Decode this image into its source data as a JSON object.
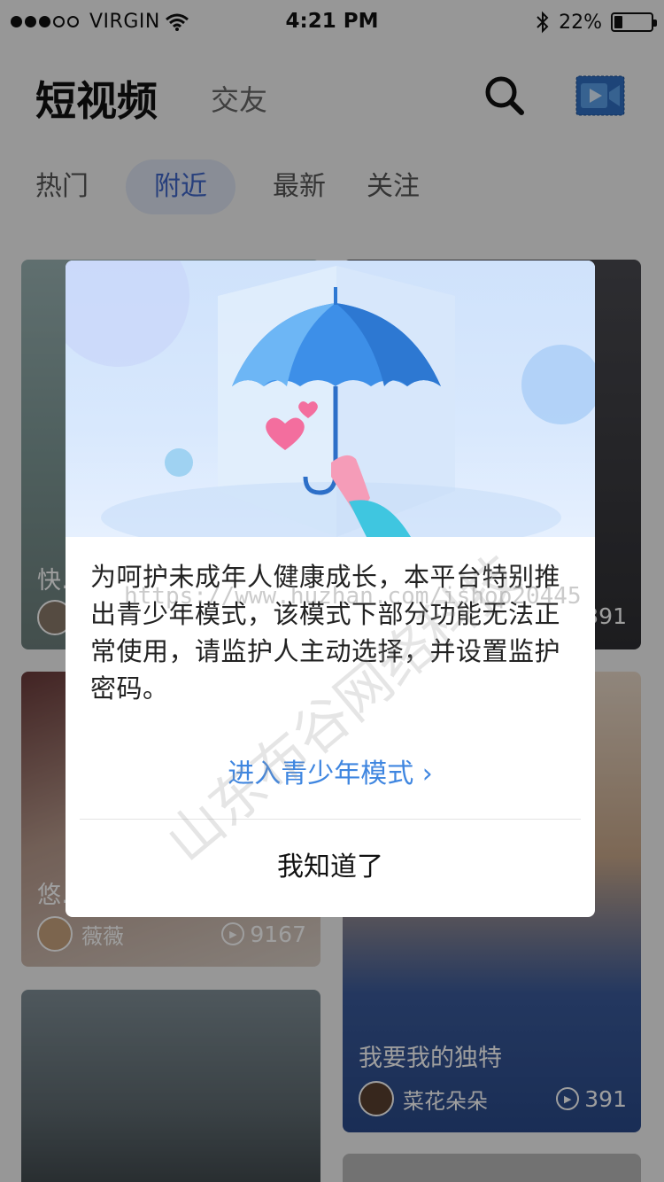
{
  "status_bar": {
    "carrier": "VIRGIN",
    "time": "4:21 PM",
    "battery": "22%",
    "battery_level": 0.22
  },
  "header": {
    "title": "短视频",
    "secondary_tab": "交友"
  },
  "tabs": [
    {
      "label": "热门",
      "active": false
    },
    {
      "label": "附近",
      "active": true
    },
    {
      "label": "最新",
      "active": false
    },
    {
      "label": "关注",
      "active": false
    }
  ],
  "feed": [
    {
      "title": "快…",
      "user": "",
      "views": ""
    },
    {
      "title": "",
      "user": "",
      "views": "391"
    },
    {
      "title": "悠…",
      "user": "薇薇",
      "views": "9167"
    },
    {
      "title": "我要我的独特",
      "user": "菜花朵朵",
      "views": "391"
    }
  ],
  "modal": {
    "message": "为呵护未成年人健康成长，本平台特别推出青少年模式，该模式下部分功能无法正常使用，请监护人主动选择，并设置监护密码。",
    "enter_label": "进入青少年模式",
    "ok_label": "我知道了"
  },
  "watermark": {
    "url": "https://www.huzhan.com/ishop20445",
    "text": "山东布谷网络科技"
  },
  "colors": {
    "accent": "#3f86e0",
    "tab_active_bg": "#dde4f2",
    "tab_active_text": "#3f66c9"
  }
}
